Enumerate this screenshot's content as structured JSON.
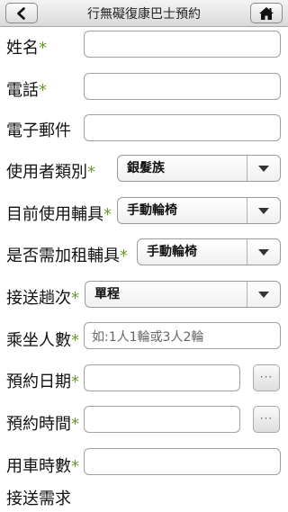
{
  "header": {
    "title": "行無礙復康巴士預約",
    "back_icon": "chevron-left-icon",
    "home_icon": "home-icon"
  },
  "form": {
    "required_mark": "*",
    "name_label": "姓名",
    "phone_label": "電話",
    "email_label": "電子郵件",
    "user_type_label": "使用者類別",
    "user_type_value": "銀髮族",
    "aid_label": "目前使用輔具",
    "aid_value": "手動輪椅",
    "rent_aid_label": "是否需加租輔具",
    "rent_aid_value": "手動輪椅",
    "trip_label": "接送趟次",
    "trip_value": "單程",
    "passengers_label": "乘坐人數",
    "passengers_placeholder": "如:1人1輪或3人2輪",
    "date_label": "預約日期",
    "date_picker_label": "···",
    "time_label": "預約時間",
    "time_picker_label": "···",
    "hours_label": "用車時數",
    "needs_label": "接送需求"
  }
}
